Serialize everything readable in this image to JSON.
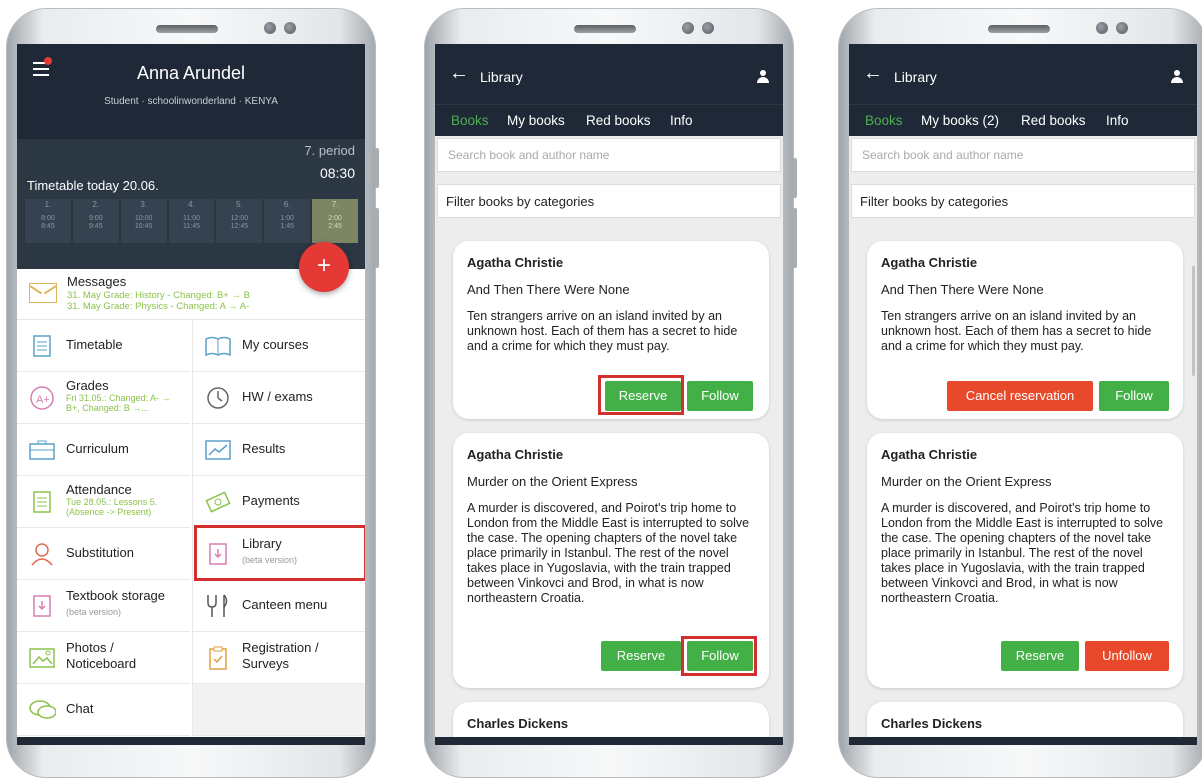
{
  "home": {
    "user_name": "Anna Arundel",
    "user_sub": "Student · schoolinwonderland · KENYA",
    "period_label": "7. period",
    "period_time": "08:30",
    "timetable_title": "Timetable today 20.06.",
    "periods": [
      {
        "n": "1.",
        "from": "8:00",
        "to": "8:45"
      },
      {
        "n": "2.",
        "from": "9:00",
        "to": "9:45"
      },
      {
        "n": "3.",
        "from": "10:00",
        "to": "10:45"
      },
      {
        "n": "4.",
        "from": "11:00",
        "to": "11:45"
      },
      {
        "n": "5.",
        "from": "12:00",
        "to": "12:45"
      },
      {
        "n": "6.",
        "from": "1:00",
        "to": "1:45"
      },
      {
        "n": "7.",
        "from": "2:00",
        "to": "2:45"
      }
    ],
    "fab": "+",
    "messages": {
      "title": "Messages",
      "line1": "31. May   Grade: History - Changed: B+ → B",
      "line2": "31. May   Grade: Physics - Changed: A → A-"
    },
    "tiles": {
      "timetable": "Timetable",
      "my_courses": "My courses",
      "grades": "Grades",
      "grades_sub": "Fri 31.05.: Changed: A- → B+, Changed: B →...",
      "hw": "HW / exams",
      "curriculum": "Curriculum",
      "results": "Results",
      "attendance": "Attendance",
      "attendance_sub": "Tue 28.05.: Lessons 5. (Absence -> Present)",
      "payments": "Payments",
      "substitution": "Substitution",
      "library": "Library",
      "library_sub": "(beta version)",
      "textbook": "Textbook storage",
      "textbook_sub": "(beta version)",
      "canteen": "Canteen menu",
      "photos": "Photos /",
      "photos2": "Noticeboard",
      "registration": "Registration /",
      "registration2": "Surveys",
      "chat": "Chat"
    }
  },
  "library_a": {
    "title": "Library",
    "tabs": [
      "Books",
      "My books",
      "Red books",
      "Info"
    ],
    "search_placeholder": "Search book and author name",
    "filter": "Filter books by categories",
    "books": [
      {
        "author": "Agatha Christie",
        "title": "And Then There Were None",
        "desc": "Ten strangers arrive on an island invited by an unknown host. Each of them has a secret to hide and a crime for which they must pay.",
        "btn1": "Reserve",
        "btn2": "Follow"
      },
      {
        "author": "Agatha Christie",
        "title": "Murder on the Orient Express",
        "desc": "A murder is discovered, and Poirot's trip home to London from the Middle East is interrupted to solve the case. The opening chapters of the novel take place primarily in Istanbul. The rest of the novel takes place in Yugoslavia, with the train trapped between Vinkovci and Brod, in what is now northeastern Croatia.",
        "btn1": "Reserve",
        "btn2": "Follow"
      },
      {
        "author": "Charles Dickens"
      }
    ]
  },
  "library_b": {
    "title": "Library",
    "tabs": [
      "Books",
      "My books (2)",
      "Red books",
      "Info"
    ],
    "search_placeholder": "Search book and author name",
    "filter": "Filter books by categories",
    "books": [
      {
        "author": "Agatha Christie",
        "title": "And Then There Were None",
        "desc": "Ten strangers arrive on an island invited by an unknown host. Each of them has a secret to hide and a crime for which they must pay.",
        "btn1": "Cancel reservation",
        "btn2": "Follow"
      },
      {
        "author": "Agatha Christie",
        "title": "Murder on the Orient Express",
        "desc": "A murder is discovered, and Poirot's trip home to London from the Middle East is interrupted to solve the case. The opening chapters of the novel take place primarily in Istanbul. The rest of the novel takes place in Yugoslavia, with the train trapped between Vinkovci and Brod, in what is now northeastern Croatia.",
        "btn1": "Reserve",
        "btn2": "Unfollow"
      },
      {
        "author": "Charles Dickens"
      }
    ]
  },
  "colors": {
    "header": "#1e2836",
    "accent_green": "#43b047",
    "accent_red": "#e8492a",
    "highlight": "#d32f2f"
  }
}
